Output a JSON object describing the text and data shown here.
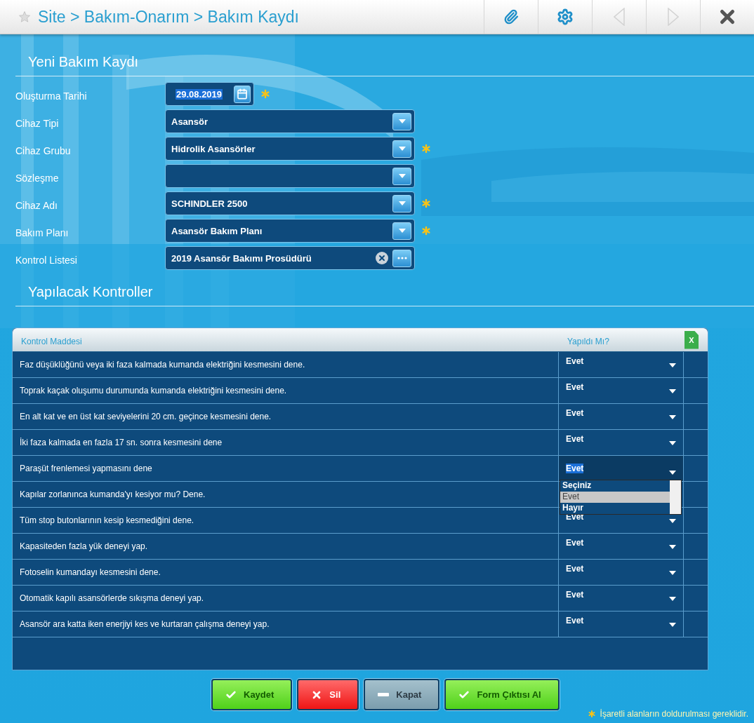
{
  "header": {
    "breadcrumb": "Site > Bakım-Onarım > Bakım Kaydı",
    "tools": [
      {
        "kind": "attach",
        "disabled": false
      },
      {
        "kind": "settings",
        "disabled": false
      },
      {
        "kind": "previous",
        "disabled": true
      },
      {
        "kind": "next",
        "disabled": true
      },
      {
        "kind": "close",
        "disabled": false
      }
    ]
  },
  "form": {
    "title": "Yeni Bakım Kaydı",
    "fields": [
      {
        "label": "Oluşturma Tarihi",
        "kind": "date",
        "value": "29.08.2019",
        "required": true,
        "text_selected": true
      },
      {
        "label": "Cihaz Tipi",
        "kind": "select",
        "value": "Asansör",
        "required": false
      },
      {
        "label": "Cihaz Grubu",
        "kind": "select",
        "value": "Hidrolik Asansörler",
        "required": true
      },
      {
        "label": "Sözleşme",
        "kind": "select",
        "required": false
      },
      {
        "label": "Cihaz Adı",
        "kind": "select",
        "value": "SCHINDLER 2500",
        "required": true
      },
      {
        "label": "Bakım Planı",
        "kind": "select",
        "value": "Asansör Bakım Planı",
        "required": true
      },
      {
        "label": "Kontrol Listesi",
        "kind": "lookup",
        "value": "2019 Asansör Bakımı Prosüdürü",
        "required": false
      }
    ]
  },
  "checks": {
    "title": "Yapılacak Kontroller",
    "columns": [
      "Kontrol Maddesi",
      "Yapıldı Mı?"
    ],
    "export_label": "X",
    "rows": [
      {
        "item": "Faz düşüklüğünü veya iki faza kalmada kumanda elektriğini kesmesini dene.",
        "answer": "Evet",
        "expanded": false
      },
      {
        "item": "Toprak kaçak oluşumu durumunda kumanda elektriğini kesmesini dene.",
        "answer": "Evet",
        "expanded": false
      },
      {
        "item": "En alt kat ve en üst kat seviyelerini 20 cm. geçince kesmesini dene.",
        "answer": "Evet",
        "expanded": false
      },
      {
        "item": "İki faza kalmada en fazla 17 sn. sonra kesmesini dene",
        "answer": "Evet",
        "expanded": false
      },
      {
        "item": "Paraşüt frenlemesi yapmasını dene",
        "answer": "Evet",
        "expanded": true,
        "options": [
          {
            "label": "Seçiniz",
            "selected": false
          },
          {
            "label": "Evet",
            "selected": true
          },
          {
            "label": "Hayır",
            "selected": false
          }
        ]
      },
      {
        "item": "Kapılar zorlanınca kumanda'yı kesiyor mu? Dene.",
        "expanded": false
      },
      {
        "item": "Tüm stop butonlarının kesip kesmediğini dene.",
        "answer": "Evet",
        "expanded": false
      },
      {
        "item": "Kapasiteden fazla yük deneyi yap.",
        "answer": "Evet",
        "expanded": false
      },
      {
        "item": "Fotoselin kumandayı kesmesini dene.",
        "answer": "Evet",
        "expanded": false
      },
      {
        "item": "Otomatik kapılı asansörlerde sıkışma deneyi yap.",
        "answer": "Evet",
        "expanded": false
      },
      {
        "item": "Asansör ara katta iken enerjiyi kes ve kurtaran çalışma deneyi yap.",
        "answer": "Evet",
        "expanded": false
      }
    ]
  },
  "actions": [
    {
      "kind": "save",
      "label": "Kaydet"
    },
    {
      "kind": "delete",
      "label": "Sil"
    },
    {
      "kind": "close",
      "label": "Kapat"
    },
    {
      "kind": "print",
      "label": "Form Çıktısı Al"
    }
  ],
  "footnote": "İşaretli alanların doldurulması gereklidir."
}
